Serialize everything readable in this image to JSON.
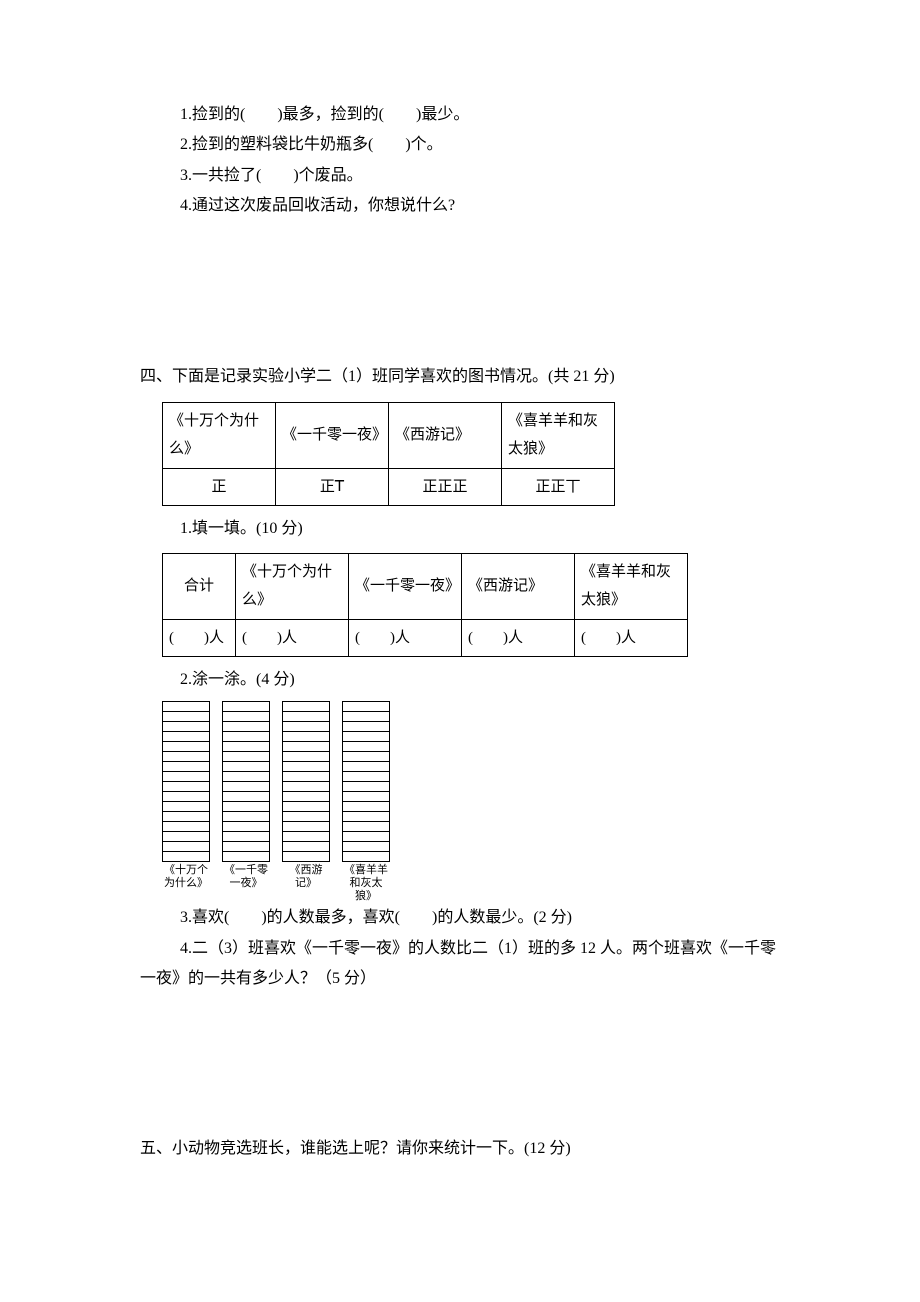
{
  "q3": {
    "line1": "1.捡到的(　　)最多，捡到的(　　)最少。",
    "line2": "2.捡到的塑料袋比牛奶瓶多(　　)个。",
    "line3": "3.一共捡了(　　)个废品。",
    "line4": "4.通过这次废品回收活动，你想说什么?"
  },
  "s4": {
    "heading": "四、下面是记录实验小学二（1）班同学喜欢的图书情况。(共 21 分)",
    "books": {
      "b1": "《十万个为什么》",
      "b2": "《一千零一夜》",
      "b3": "《西游记》",
      "b4": "《喜羊羊和灰太狼》"
    },
    "tally": {
      "t1": "正",
      "t2": "正𝖳",
      "t3": "正正正",
      "t4": "正正丅"
    },
    "q1_label": "1.填一填。(10 分)",
    "fill_header": {
      "total": "合计",
      "b1": "《十万个为什么》",
      "b2": "《一千零一夜》",
      "b3": "《西游记》",
      "b4": "《喜羊羊和灰太狼》"
    },
    "fill_row": "(　　)人",
    "q2_label": "2.涂一涂。(4 分)",
    "bar_labels": {
      "l1": "《十万个为什么》",
      "l2": "《一千零一夜》",
      "l3": "《西游记》",
      "l4": "《喜羊羊和灰太狼》"
    },
    "q3_line": "3.喜欢(　　)的人数最多，喜欢(　　)的人数最少。(2 分)",
    "q4_line1": "4.二（3）班喜欢《一千零一夜》的人数比二（1）班的多 12 人。两个班喜欢《一千零",
    "q4_line2": "一夜》的一共有多少人？（5 分）"
  },
  "s5": {
    "heading": "五、小动物竞选班长，谁能选上呢？请你来统计一下。(12 分)"
  },
  "chart_data": {
    "type": "bar",
    "categories": [
      "《十万个为什么》",
      "《一千零一夜》",
      "《西游记》",
      "《喜羊羊和灰太狼》"
    ],
    "values": [
      null,
      null,
      null,
      null
    ],
    "ylim": [
      0,
      16
    ],
    "note": "Empty tally grid with 16 rows per column for student to color in"
  }
}
